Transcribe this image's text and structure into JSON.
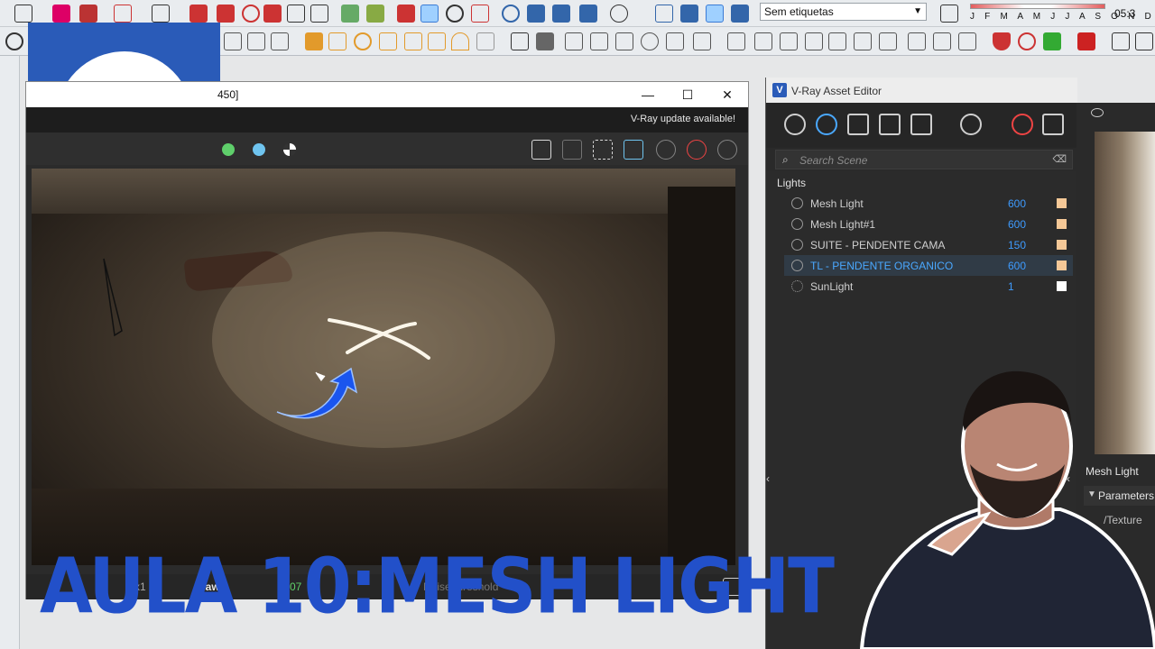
{
  "sketchup": {
    "tag_select_value": "Sem etiquetas",
    "months": "J F M A M J J A S O N D",
    "time": "05:3"
  },
  "vfb": {
    "title": "450]",
    "update_notice": "V-Ray update available!",
    "status": {
      "zoom": "x1",
      "mode": "Raw",
      "value": "0.07",
      "hint": "Noise threshold"
    }
  },
  "asset_editor": {
    "title": "V-Ray Asset Editor",
    "search_placeholder": "Search Scene",
    "category": "Lights",
    "lights": [
      {
        "name": "Mesh Light",
        "value": "600",
        "color": "#f5c897",
        "selected": false
      },
      {
        "name": "Mesh Light#1",
        "value": "600",
        "color": "#f5c897",
        "selected": false
      },
      {
        "name": "SUITE - PENDENTE CAMA",
        "value": "150",
        "color": "#f5c897",
        "selected": false
      },
      {
        "name": "TL - PENDENTE ORGANICO",
        "value": "600",
        "color": "#f5c897",
        "selected": true
      },
      {
        "name": "SunLight",
        "value": "1",
        "color": "#ffffff",
        "selected": false
      }
    ]
  },
  "side_panel": {
    "asset_name": "Mesh Light",
    "section": "Parameters",
    "field": "/Texture"
  },
  "headline": "AULA 10:MESH LIGHT",
  "colors": {
    "vray_blue": "#2a5bb8",
    "headline_blue": "#2250c9",
    "accent_blue": "#3e9bff"
  }
}
